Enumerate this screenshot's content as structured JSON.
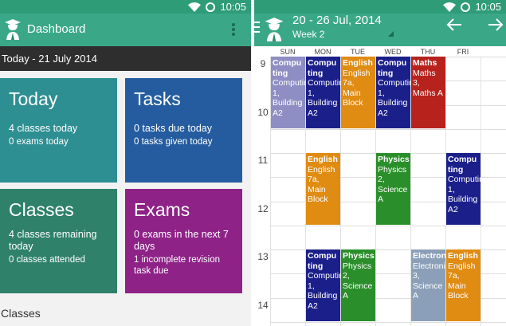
{
  "left": {
    "status_time": "10:05",
    "title": "Dashboard",
    "date_bar": "Today - 21 July 2014",
    "tiles": {
      "today": {
        "title": "Today",
        "line1": "4 classes today",
        "line2": "0 exams today"
      },
      "tasks": {
        "title": "Tasks",
        "line1": "0 tasks due today",
        "line2": "0 tasks given today"
      },
      "classes": {
        "title": "Classes",
        "line1": "4 classes remaining today",
        "line2": "0 classes attended"
      },
      "exams": {
        "title": "Exams",
        "line1": "0 exams in the next 7 days",
        "line2": "1 incomplete revision task due"
      }
    },
    "section_label": "Classes"
  },
  "right": {
    "status_time": "10:05",
    "range": "20 - 26 Jul, 2014",
    "week": "Week 2",
    "days": [
      "SUN",
      "MON",
      "TUE",
      "WED",
      "THU",
      "FRI"
    ],
    "hours": [
      "9",
      "10",
      "11",
      "12",
      "13",
      "14"
    ],
    "events": [
      {
        "subject": "Compu ting",
        "detail": "Computing 1, Building A2",
        "day": 0,
        "start": 9.0,
        "end": 10.5
      },
      {
        "subject": "Compu ting",
        "detail": "Computing 1, Building A2",
        "day": 1,
        "start": 9.0,
        "end": 10.5
      },
      {
        "subject": "English",
        "detail": "English 7a, Main Block",
        "day": 2,
        "start": 9.0,
        "end": 10.5
      },
      {
        "subject": "Compu ting",
        "detail": "Computing 1, Building A2",
        "day": 3,
        "start": 9.0,
        "end": 10.5
      },
      {
        "subject": "Maths",
        "detail": "Maths 3, Maths A",
        "day": 4,
        "start": 9.0,
        "end": 10.5
      },
      {
        "subject": "English",
        "detail": "English 7a, Main Block",
        "day": 1,
        "start": 11.0,
        "end": 12.5
      },
      {
        "subject": "Physics",
        "detail": "Physics 2, Science A",
        "day": 3,
        "start": 11.0,
        "end": 12.5
      },
      {
        "subject": "Compu ting",
        "detail": "Computing 1, Building A2",
        "day": 5,
        "start": 11.0,
        "end": 12.5
      },
      {
        "subject": "Compu ting",
        "detail": "Computing 1, Building A2",
        "day": 1,
        "start": 13.0,
        "end": 14.5
      },
      {
        "subject": "Physics",
        "detail": "Physics 2, Science A",
        "day": 2,
        "start": 13.0,
        "end": 14.5
      },
      {
        "subject": "Electronics",
        "detail": "Electronics 3, Science A",
        "day": 4,
        "start": 13.0,
        "end": 14.5
      },
      {
        "subject": "English",
        "detail": "English 7a, Main Block",
        "day": 5,
        "start": 13.0,
        "end": 14.5
      }
    ]
  },
  "colors": {
    "status": "#2f9c78",
    "appbar": "#3aa886",
    "computing_sun": "#8e8ec4",
    "computing": "#1b1f8a",
    "english": "#e08b12",
    "maths": "#b7221d",
    "physics": "#2a8f2a",
    "electronics": "#8ba0b8"
  },
  "icons": [
    "graduate-logo-icon",
    "wifi-icon",
    "ring-icon",
    "overflow-menu-icon",
    "hamburger-icon",
    "arrow-left-icon",
    "arrow-right-icon",
    "dropdown-triangle-icon"
  ]
}
